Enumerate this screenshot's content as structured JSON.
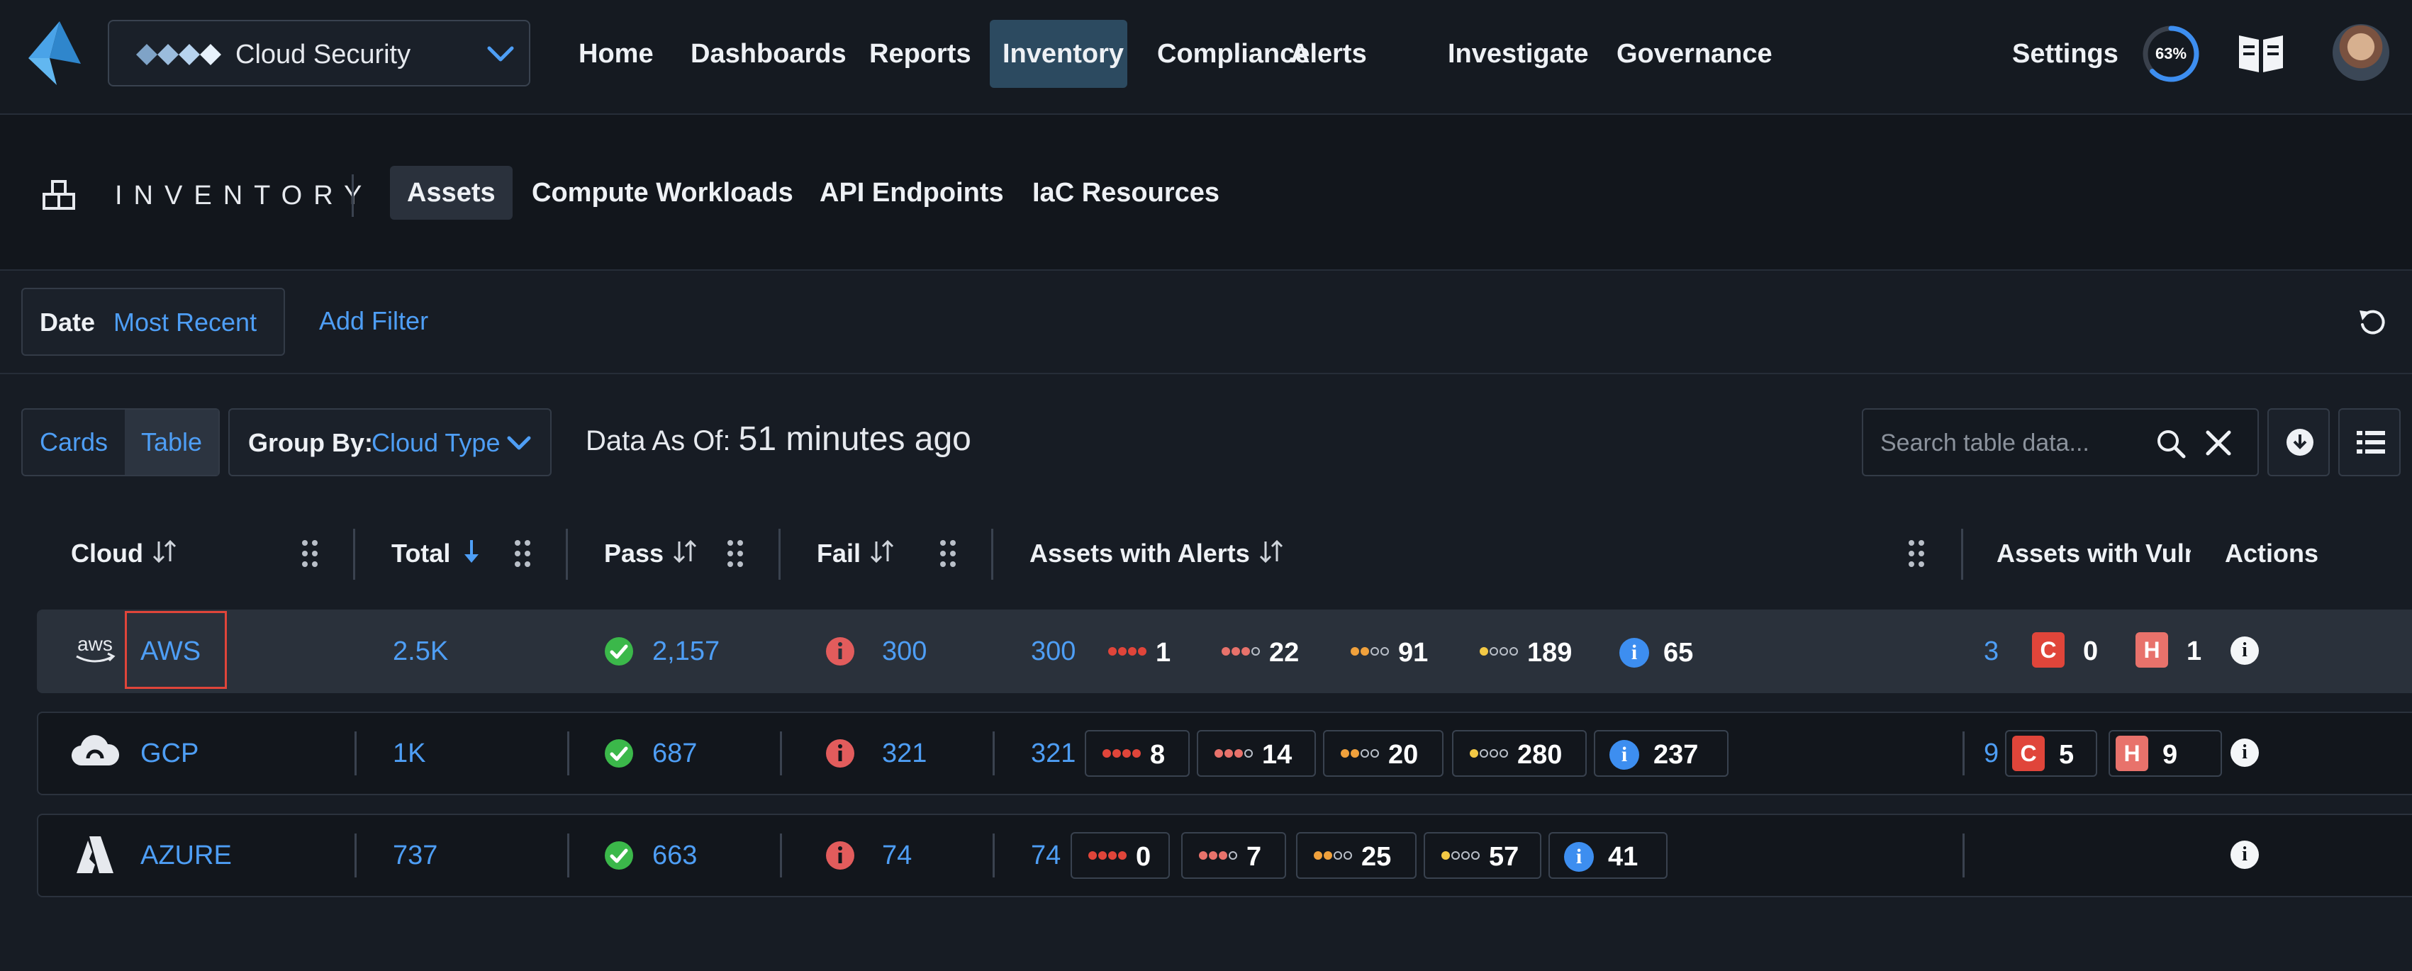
{
  "colors": {
    "accent": "#4e9ef5",
    "critical": "#e0453a",
    "high": "#e8726b",
    "medium": "#f0a13c",
    "low": "#f3c945",
    "info": "#3d8ef0",
    "pass": "#3bb84a",
    "fail": "#e25c5c"
  },
  "topnav": {
    "product": "Cloud Security",
    "items": [
      "Home",
      "Dashboards",
      "Reports",
      "Inventory",
      "Compliance",
      "Alerts",
      "Investigate",
      "Governance"
    ],
    "active": "Inventory",
    "settings": "Settings",
    "progress_label": "63%",
    "progress_value": 0.63
  },
  "subnav": {
    "title": "INVENTORY",
    "tabs": [
      "Assets",
      "Compute Workloads",
      "API Endpoints",
      "IaC Resources"
    ],
    "active": "Assets"
  },
  "filters": {
    "date_key": "Date",
    "date_value": "Most Recent",
    "add_filter": "Add Filter"
  },
  "toolbar": {
    "cards": "Cards",
    "table": "Table",
    "groupby_key": "Group By:",
    "groupby_value": "Cloud Type",
    "data_as_of_key": "Data As Of:",
    "data_as_of_value": "51 minutes ago",
    "search_placeholder": "Search table data..."
  },
  "table": {
    "columns": [
      "Cloud",
      "Total",
      "Pass",
      "Fail",
      "Assets with Alerts",
      "Assets with Vulns",
      "Actions"
    ],
    "rows": [
      {
        "cloud": "AWS",
        "icon": "aws-icon",
        "total": "2.5K",
        "pass": "2,157",
        "fail": "300",
        "alerts": "300",
        "alert_breakdown": [
          "1",
          "22",
          "91",
          "189",
          "65"
        ],
        "vulns": "3",
        "vuln_c": "0",
        "vuln_h": "1"
      },
      {
        "cloud": "GCP",
        "icon": "gcp-icon",
        "total": "1K",
        "pass": "687",
        "fail": "321",
        "alerts": "321",
        "alert_breakdown": [
          "8",
          "14",
          "20",
          "280",
          "237"
        ],
        "vulns": "9",
        "vuln_c": "5",
        "vuln_h": "9"
      },
      {
        "cloud": "AZURE",
        "icon": "azure-icon",
        "total": "737",
        "pass": "663",
        "fail": "74",
        "alerts": "74",
        "alert_breakdown": [
          "0",
          "7",
          "25",
          "57",
          "41"
        ],
        "vulns": "",
        "vuln_c": "",
        "vuln_h": ""
      }
    ],
    "severity_letters": {
      "critical": "C",
      "high": "H"
    }
  }
}
